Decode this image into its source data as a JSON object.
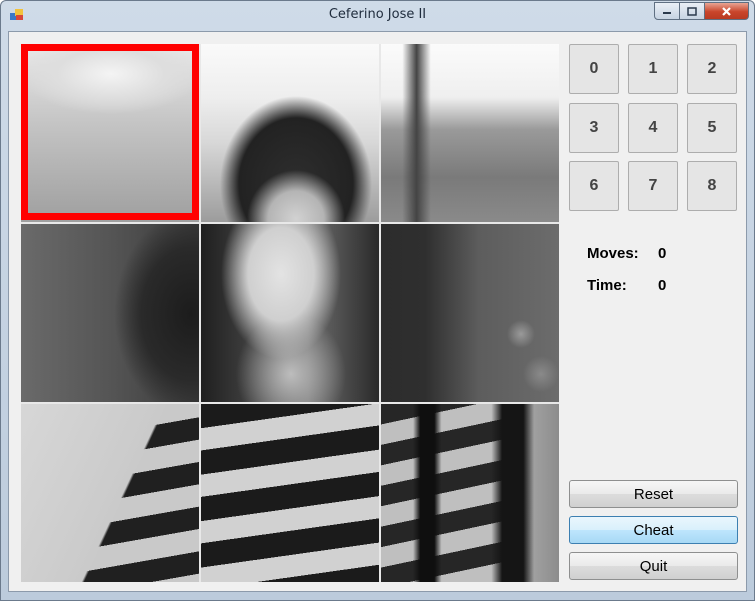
{
  "window": {
    "title": "Ceferino Jose II"
  },
  "number_buttons": [
    "0",
    "1",
    "2",
    "3",
    "4",
    "5",
    "6",
    "7",
    "8"
  ],
  "stats": {
    "moves_label": "Moves:",
    "moves_value": "0",
    "time_label": "Time:",
    "time_value": "0"
  },
  "actions": {
    "reset": "Reset",
    "cheat": "Cheat",
    "quit": "Quit"
  },
  "puzzle": {
    "grid_rows": 3,
    "grid_cols": 3,
    "selected_tile": 0,
    "highlight_color": "#ff0000"
  }
}
